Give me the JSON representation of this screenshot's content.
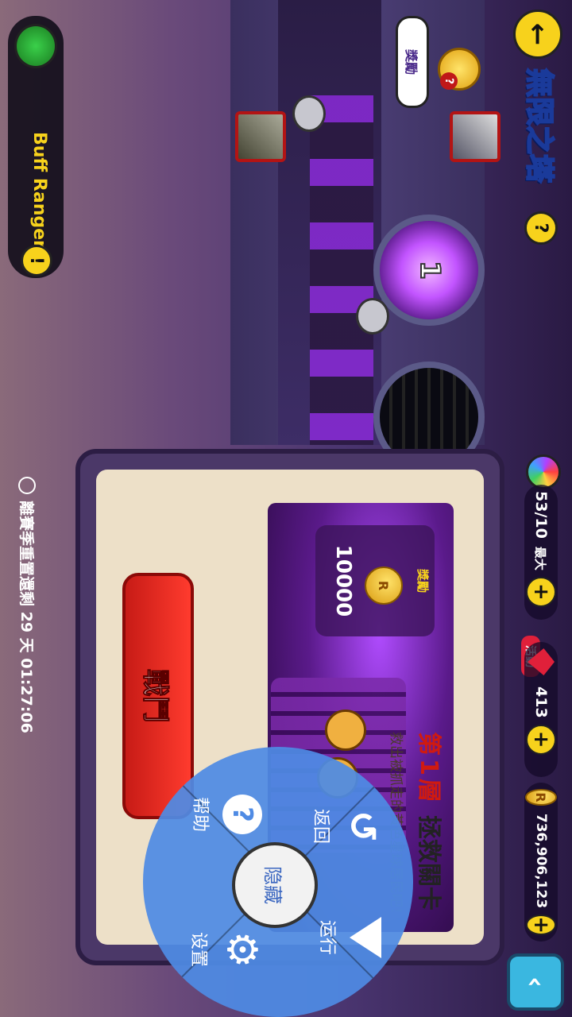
{
  "header": {
    "title": "無限之塔",
    "help_icon": "question-icon",
    "reward_label": "獎勵",
    "trophy_badge": "?"
  },
  "resources": {
    "energy": "53/10",
    "energy_max_label": "最大",
    "event_badge": "活動",
    "gems": "413",
    "coins": "736,906,123"
  },
  "left_panel": {
    "character_name": "Buff Ranger",
    "alert_icon": "!"
  },
  "tower": {
    "floor_number": "1"
  },
  "stage_panel": {
    "floor_prefix": "第",
    "floor_value": "1",
    "floor_suffix": "層",
    "stage_title": "拯救關卡",
    "description": "救出被抓走的黃色星球居民吧！",
    "reward_label": "獎勵",
    "reward_amount": "10000",
    "fight_button": "戰鬥"
  },
  "season": {
    "countdown": "離賽季重置還剩 29 天 01:27:06"
  },
  "radial_menu": {
    "center": "隐藏",
    "back": "返回",
    "run": "运行",
    "help": "帮助",
    "settings": "设置"
  },
  "colors": {
    "accent_yellow": "#f7d21c",
    "menu_blue": "#4f8be4",
    "fight_red": "#e0261c",
    "title_blue": "#1a3a9a",
    "tower_purple": "#b04cff"
  }
}
